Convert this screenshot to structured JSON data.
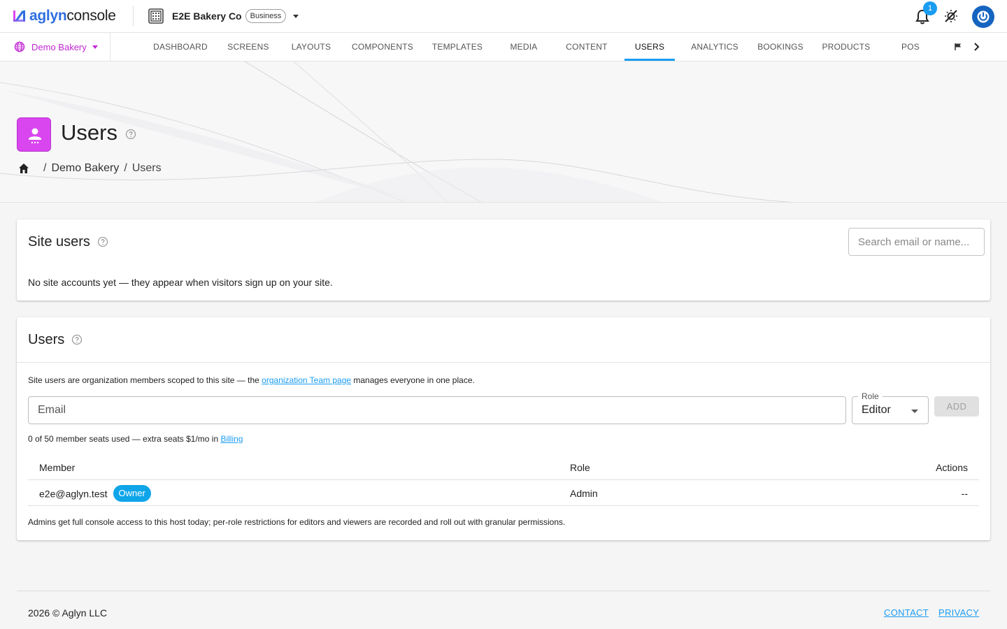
{
  "app": {
    "logo_part1": "aglyn",
    "logo_part2": "console",
    "org_name": "E2E Bakery Co",
    "org_plan": "Business",
    "notification_count": "1"
  },
  "nav": {
    "site_name": "Demo Bakery",
    "tabs": [
      "DASHBOARD",
      "SCREENS",
      "LAYOUTS",
      "COMPONENTS",
      "TEMPLATES",
      "MEDIA",
      "CONTENT",
      "USERS",
      "ANALYTICS",
      "BOOKINGS",
      "PRODUCTS",
      "POS"
    ],
    "active_tab": "USERS"
  },
  "page": {
    "title": "Users",
    "breadcrumb": [
      "Demo Bakery",
      "Users"
    ]
  },
  "site_users": {
    "title": "Site users",
    "search_placeholder": "Search email or name...",
    "empty_message": "No site accounts yet — they appear when visitors sign up on your site."
  },
  "users": {
    "title": "Users",
    "info_prefix": "Site users are organization members scoped to this site — the ",
    "info_link": "organization Team page",
    "info_suffix": " manages everyone in one place.",
    "email_placeholder": "Email",
    "role_label": "Role",
    "role_value": "Editor",
    "add_label": "ADD",
    "seats_prefix": "0 of 50 member seats used — extra seats $1/mo in ",
    "seats_link": "Billing",
    "columns": {
      "member": "Member",
      "role": "Role",
      "actions": "Actions"
    },
    "rows": [
      {
        "member": "e2e@aglyn.test",
        "badge": "Owner",
        "role": "Admin",
        "actions": "--"
      }
    ],
    "footnote": "Admins get full console access to this host today; per-role restrictions for editors and viewers are recorded and roll out with granular permissions."
  },
  "footer": {
    "copyright": "2026 © Aglyn LLC",
    "contact": "CONTACT",
    "privacy": "PRIVACY"
  },
  "colors": {
    "accent": "#1a9cf0",
    "site_magenta": "#c026d3",
    "page_icon_bg": "#d946ef",
    "avatar_blue": "#1565c0"
  },
  "icons": [
    "aglyn-logo-icon",
    "building-icon",
    "bell-icon",
    "theme-icon",
    "power-avatar-icon",
    "globe-icon",
    "flag-icon",
    "chevron-right-icon",
    "user-icon",
    "help-icon",
    "home-icon"
  ]
}
